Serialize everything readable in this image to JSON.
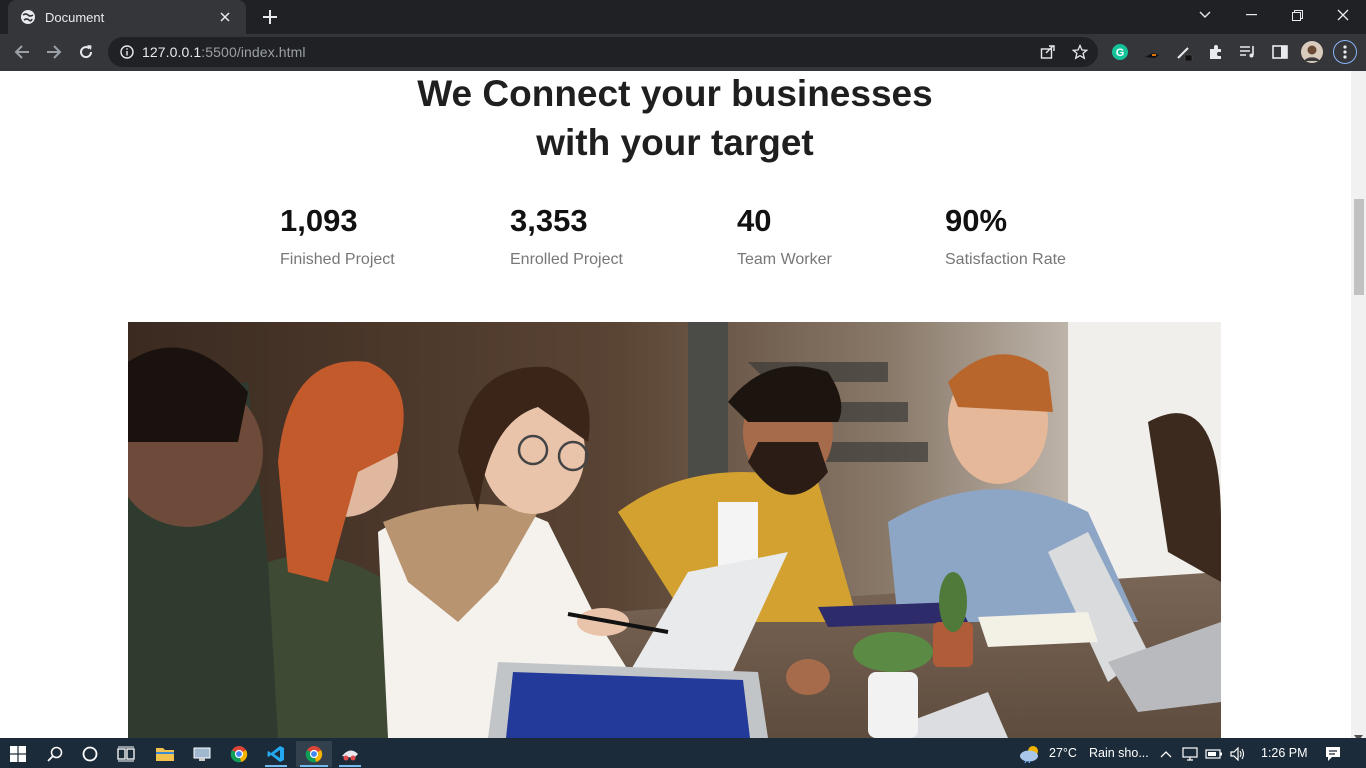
{
  "browser": {
    "tab_title": "Document",
    "url_host": "127.0.0.1",
    "url_rest": ":5500/index.html"
  },
  "page": {
    "headline_line1": "We Connect your businesses",
    "headline_line2": "with your target",
    "stats": [
      {
        "value": "1,093",
        "label": "Finished Project"
      },
      {
        "value": "3,353",
        "label": "Enrolled Project"
      },
      {
        "value": "40",
        "label": "Team Worker"
      },
      {
        "value": "90%",
        "label": "Satisfaction Rate"
      }
    ]
  },
  "taskbar": {
    "weather_temp": "27°C",
    "weather_text": "Rain sho...",
    "time": "1:26 PM"
  },
  "colors": {
    "chrome_dark": "#202124",
    "chrome_tab": "#35363a",
    "taskbar": "#1c2b39",
    "accent_blue": "#76b9ed"
  }
}
